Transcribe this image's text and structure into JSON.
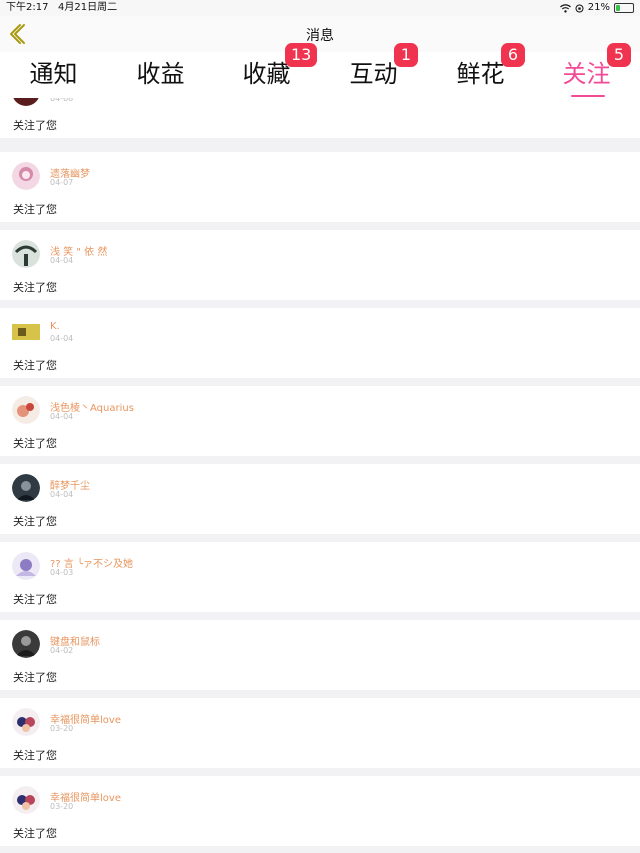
{
  "status_bar": {
    "time": "下午2:17",
    "date": "4月21日周二",
    "battery": "21%"
  },
  "nav": {
    "title": "消息"
  },
  "tabs": [
    {
      "label": "通知",
      "badge": ""
    },
    {
      "label": "收益",
      "badge": ""
    },
    {
      "label": "收藏",
      "badge": "13"
    },
    {
      "label": "互动",
      "badge": "1"
    },
    {
      "label": "鲜花",
      "badge": "6"
    },
    {
      "label": "关注",
      "badge": "5"
    }
  ],
  "active_tab": "关注",
  "colors": {
    "accent": "#f24a95",
    "badge": "#f0334f",
    "name": "#e8955e"
  },
  "items": [
    {
      "name": "",
      "date": "04-08",
      "action": "关注了您"
    },
    {
      "name": "遗落幽梦",
      "date": "04-07",
      "action": "关注了您"
    },
    {
      "name": "浅 笑 \" 依 然",
      "date": "04-04",
      "action": "关注了您"
    },
    {
      "name": "K.",
      "date": "04-04",
      "action": "关注了您"
    },
    {
      "name": "浅色棱丶Aquarius",
      "date": "04-04",
      "action": "关注了您"
    },
    {
      "name": "醉梦千尘",
      "date": "04-04",
      "action": "关注了您"
    },
    {
      "name": "?? 言 ╰ァ不シ及她",
      "date": "04-03",
      "action": "关注了您"
    },
    {
      "name": "键盘和鼠标",
      "date": "04-02",
      "action": "关注了您"
    },
    {
      "name": "幸福很简单love",
      "date": "03-20",
      "action": "关注了您"
    },
    {
      "name": "幸福很简单love",
      "date": "03-20",
      "action": "关注了您"
    }
  ]
}
